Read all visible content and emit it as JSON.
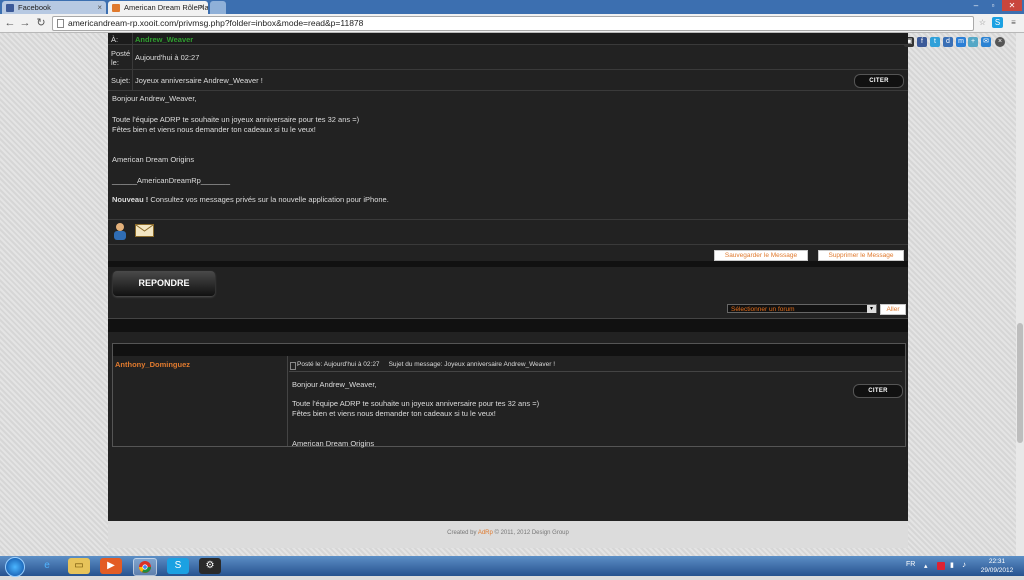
{
  "browser": {
    "tabs": [
      {
        "label": "Facebook"
      },
      {
        "label": "American Dream RôlePlay"
      }
    ],
    "url": "americandream-rp.xooit.com/privmsg.php?folder=inbox&mode=read&p=11878"
  },
  "message": {
    "to_label": "À:",
    "to_value": "Andrew_Weaver",
    "posted_label_1": "Posté",
    "posted_label_2": "le:",
    "posted_value": "Aujourd'hui à 02:27",
    "subject_label": "Sujet:",
    "subject_value": "Joyeux anniversaire Andrew_Weaver !",
    "quote_label": "CITER",
    "body": {
      "line1": "Bonjour Andrew_Weaver,",
      "line2": "Toute l'équipe ADRP te souhaite un joyeux anniversaire pour tes 32 ans =)",
      "line3": "Fêtes bien et viens nous demander ton cadeaux si tu le veux!",
      "line4": "American Dream Origins",
      "line5": "______AmericanDreamRp_______",
      "notice_bold": "Nouveau !",
      "notice_text": " Consultez vos messages privés sur la nouvelle application pour iPhone."
    },
    "save_label": "Sauvegarder le Message",
    "delete_label": "Supprimer le Message"
  },
  "reply_label": "REPONDRE",
  "jump": {
    "select_value": "Sélectionner un forum",
    "go_label": "Aller"
  },
  "history": {
    "post_author": "Anthony_Dominguez",
    "post_meta": "Posté le: Aujourd'hui à 02:27     Sujet du message: Joyeux anniversaire Andrew_Weaver !",
    "quote_label": "CITER",
    "line1": "Bonjour Andrew_Weaver,",
    "line2": "Toute l'équipe ADRP te souhaite un joyeux anniversaire pour tes 32 ans =)",
    "line3": "Fêtes bien et viens nous demander ton cadeaux si tu le veux!",
    "line4": "American Dream Origins"
  },
  "footer": {
    "credit_prefix": "Created by ",
    "credit_brand": "AdRp",
    "credit_suffix": " © 2011, 2012 Design Group"
  },
  "taskbar": {
    "lang": "FR",
    "time": "22:31",
    "date": "29/09/2012"
  },
  "colors": {
    "accent_orange": "#e07a2e",
    "recipient_green": "#2f9e2f",
    "page_dark": "#222222"
  }
}
